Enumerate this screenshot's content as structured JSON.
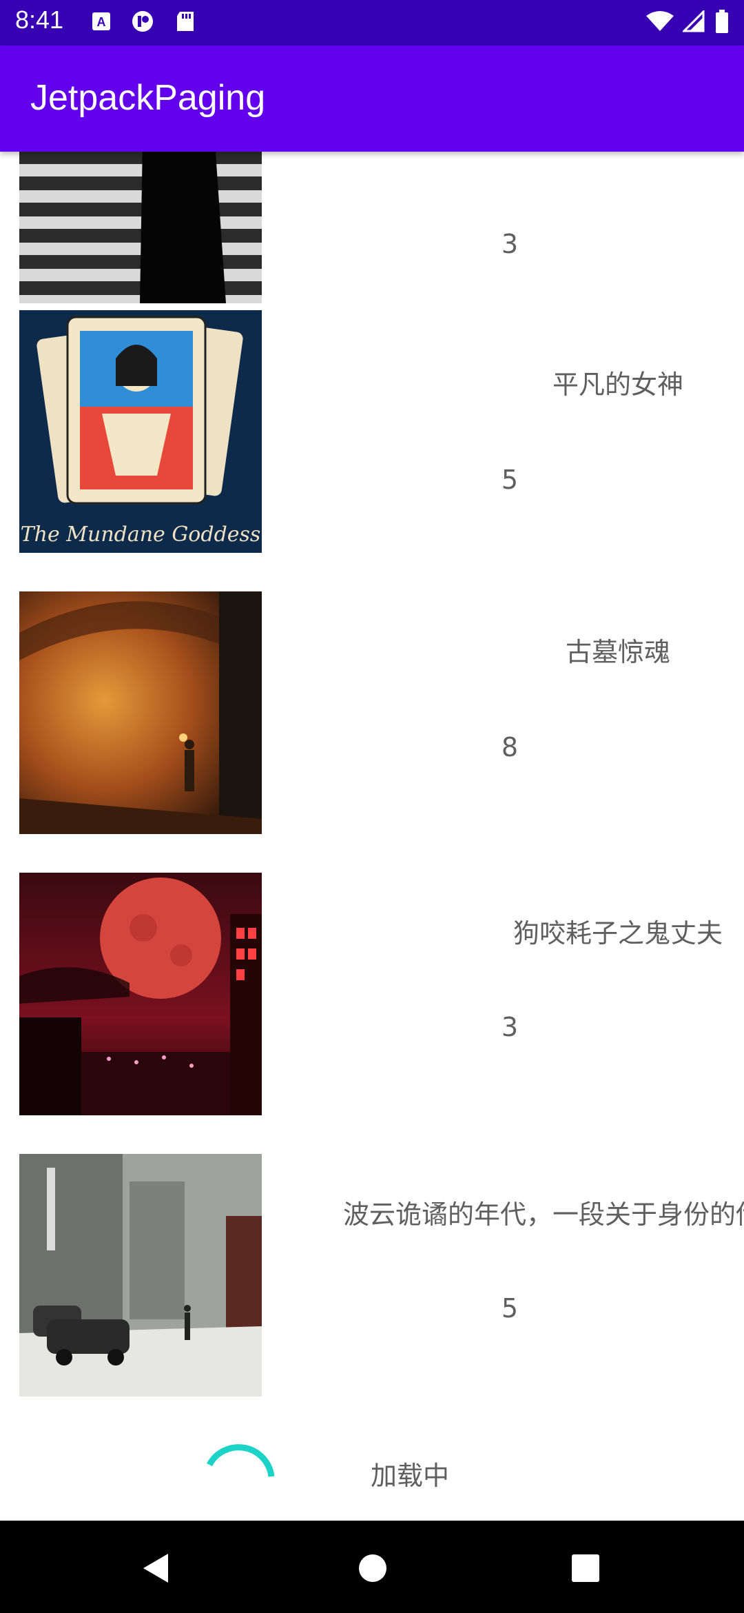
{
  "status_bar": {
    "time": "8:41",
    "left_icons": [
      "a-notification-icon",
      "headset-icon",
      "sd-card-icon"
    ],
    "right_icons": [
      "wifi-icon",
      "cellular-signal-icon",
      "battery-icon"
    ]
  },
  "app_bar": {
    "title": "JetpackPaging"
  },
  "items": [
    {
      "title": "",
      "number": "3",
      "image": "umbrella-crosswalk-photo"
    },
    {
      "title": "平凡的女神",
      "number": "5",
      "image": "mundane-goddess-poster"
    },
    {
      "title": "古墓惊魂",
      "number": "8",
      "image": "tomb-corridor-poster"
    },
    {
      "title": "狗咬耗子之鬼丈夫",
      "number": "3",
      "image": "red-moon-city-poster"
    },
    {
      "title": "波云诡谲的年代，一段关于身份的传奇缓缓上演",
      "number": "5",
      "image": "snowy-street-poster"
    }
  ],
  "footer": {
    "loading_label": "加载中"
  },
  "nav_bar": {
    "buttons": [
      "back-icon",
      "home-icon",
      "recents-icon"
    ]
  },
  "colors": {
    "status_bar": "#3700B3",
    "app_bar": "#6200EE",
    "spinner": "#1DD3C7",
    "text": "#5f5f5f"
  }
}
